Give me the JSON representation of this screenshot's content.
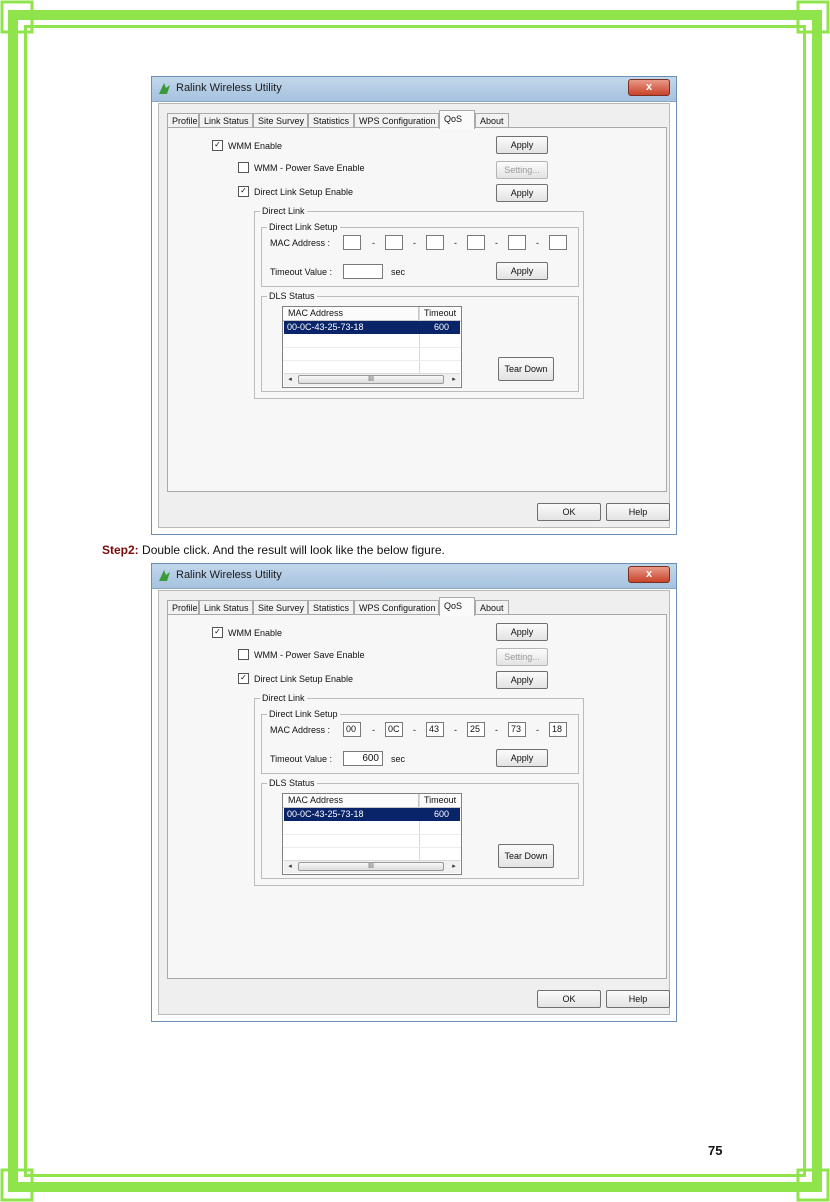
{
  "step": {
    "label": "Step2:",
    "text": "Double click. And the result will look like the below figure."
  },
  "page_number": "75",
  "frame_color": "#8ee44a",
  "screens": [
    {
      "window_title": "Ralink Wireless Utility",
      "close_label": "x",
      "tabs": [
        "Profile",
        "Link Status",
        "Site Survey",
        "Statistics",
        "WPS Configuration",
        "QoS",
        "About"
      ],
      "active_tab": "QoS",
      "wmm_enable": {
        "label": "WMM Enable",
        "checked": true,
        "mark": "✓"
      },
      "wmm_power_save": {
        "label": "WMM - Power Save Enable",
        "checked": false,
        "mark": ""
      },
      "direct_link_setup_enable": {
        "label": "Direct Link Setup Enable",
        "checked": true,
        "mark": "✓"
      },
      "apply_label": "Apply",
      "setting_label": "Setting...",
      "direct_link_title": "Direct Link",
      "direct_link_setup_title": "Direct Link Setup",
      "mac_label": "MAC Address :",
      "mac_values": [
        "",
        "",
        "",
        "",
        "",
        ""
      ],
      "dash": "-",
      "timeout_label": "Timeout Value :",
      "timeout_value": "",
      "timeout_unit": "sec",
      "dls_status_title": "DLS Status",
      "list_headers": [
        "MAC Address",
        "Timeout"
      ],
      "list_rows": [
        {
          "mac": "00-0C-43-25-73-18",
          "timeout": "600"
        }
      ],
      "scroll_thumb": "III",
      "teardown_label": "Tear Down",
      "ok_label": "OK",
      "help_label": "Help"
    },
    {
      "window_title": "Ralink Wireless Utility",
      "close_label": "x",
      "tabs": [
        "Profile",
        "Link Status",
        "Site Survey",
        "Statistics",
        "WPS Configuration",
        "QoS",
        "About"
      ],
      "active_tab": "QoS",
      "wmm_enable": {
        "label": "WMM Enable",
        "checked": true,
        "mark": "✓"
      },
      "wmm_power_save": {
        "label": "WMM - Power Save Enable",
        "checked": false,
        "mark": ""
      },
      "direct_link_setup_enable": {
        "label": "Direct Link Setup Enable",
        "checked": true,
        "mark": "✓"
      },
      "apply_label": "Apply",
      "setting_label": "Setting...",
      "direct_link_title": "Direct Link",
      "direct_link_setup_title": "Direct Link Setup",
      "mac_label": "MAC Address :",
      "mac_values": [
        "00",
        "0C",
        "43",
        "25",
        "73",
        "18"
      ],
      "dash": "-",
      "timeout_label": "Timeout Value :",
      "timeout_value": "600",
      "timeout_unit": "sec",
      "dls_status_title": "DLS Status",
      "list_headers": [
        "MAC Address",
        "Timeout"
      ],
      "list_rows": [
        {
          "mac": "00-0C-43-25-73-18",
          "timeout": "600"
        }
      ],
      "scroll_thumb": "III",
      "teardown_label": "Tear Down",
      "ok_label": "OK",
      "help_label": "Help"
    }
  ]
}
